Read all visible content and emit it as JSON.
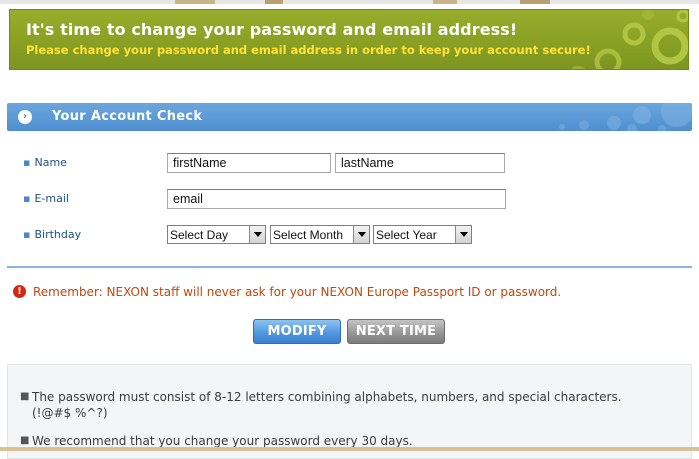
{
  "banner": {
    "title": "It's time to change your password and email address!",
    "subtitle": "Please change your password and email address in order to keep your account secure!"
  },
  "section": {
    "title": "Your Account Check",
    "icon": "circle-arrow-right-icon"
  },
  "form": {
    "name_label": "Name",
    "first_name_value": "firstName",
    "last_name_value": "lastName",
    "email_label": "E-mail",
    "email_value": "email",
    "birthday_label": "Birthday",
    "day_selected": "Select Day",
    "month_selected": "Select Month",
    "year_selected": "Select Year"
  },
  "notice": {
    "icon": "exclamation-icon",
    "text": "Remember: NEXON staff will never ask for your NEXON Europe Passport ID or password."
  },
  "buttons": {
    "modify": "MODIFY",
    "next_time": "NEXT TIME"
  },
  "info": {
    "items": [
      "The password must consist of 8-12 letters combining alphabets, numbers, and special characters.(!@#$ %^?)",
      "We recommend that you change your password every 30 days."
    ]
  },
  "colors": {
    "banner_green": "#8aa024",
    "banner_yellow_text": "#ffe23a",
    "section_blue": "#5a97d6",
    "notice_orange": "#c1470c",
    "modify_blue": "#4e95dd",
    "next_gray": "#939393"
  }
}
